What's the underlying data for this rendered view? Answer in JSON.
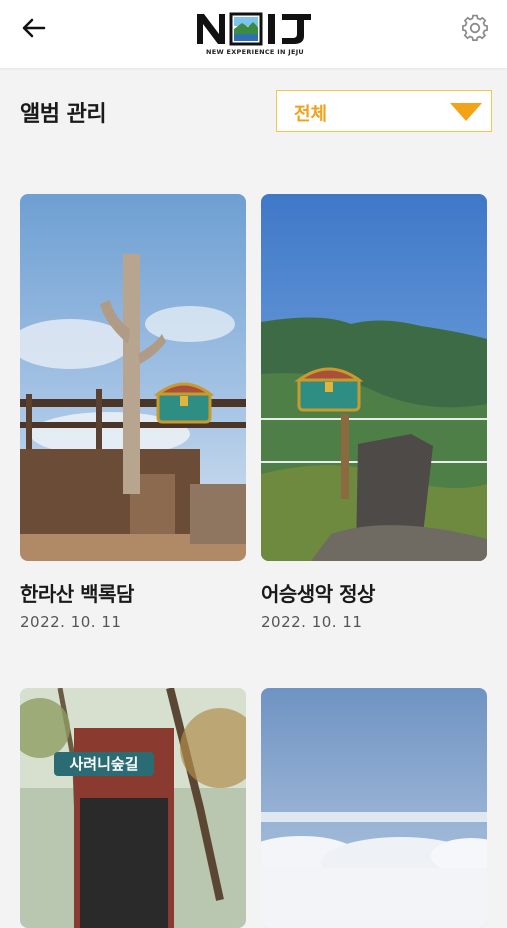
{
  "header": {
    "logo_text": "NEIJ",
    "logo_tagline": "NEW EXPERIENCE IN JEJU",
    "back_icon": "arrow-left-icon",
    "settings_icon": "gear-icon"
  },
  "page": {
    "title": "앨범 관리"
  },
  "filter": {
    "selected": "전체",
    "icon": "caret-down-icon",
    "accent": "#f0a21c"
  },
  "albums": [
    {
      "title": "한라산 백록담",
      "date": "2022. 10. 11",
      "marker": "treasure-chest-icon"
    },
    {
      "title": "어승생악 정상",
      "date": "2022. 10. 11",
      "marker": "treasure-chest-icon"
    },
    {
      "title": "",
      "date": "",
      "sign_text": "사려니숲길"
    },
    {
      "title": "",
      "date": ""
    }
  ],
  "colors": {
    "accent_yellow": "#f2c64a",
    "text_dark": "#1a1a1a",
    "background": "#f3f3f3"
  }
}
